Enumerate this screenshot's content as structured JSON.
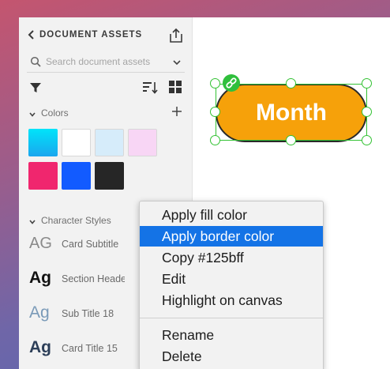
{
  "panel": {
    "header_title": "DOCUMENT ASSETS",
    "search_placeholder": "Search document assets",
    "colors_section": "Colors",
    "character_styles_section": "Character Styles",
    "colors": [
      {
        "name": "cyan",
        "value": "#12bff0"
      },
      {
        "name": "white",
        "value": "#ffffff"
      },
      {
        "name": "light-blue",
        "value": "#d6ecfa"
      },
      {
        "name": "light-pink",
        "value": "#f8d6f5"
      },
      {
        "name": "pink",
        "value": "#f0266e"
      },
      {
        "name": "blue",
        "value": "#125bff"
      },
      {
        "name": "dark",
        "value": "#262626"
      }
    ],
    "character_styles": [
      {
        "glyph": "AG",
        "name": "Card Subtitle"
      },
      {
        "glyph": "Ag",
        "name": "Section Header"
      },
      {
        "glyph": "Ag",
        "name": "Sub Title 18"
      },
      {
        "glyph": "Ag",
        "name": "Card Title 15"
      }
    ]
  },
  "canvas": {
    "shape_text": "Month",
    "shape_fill": "#f6a10a",
    "selection_color": "#33c233"
  },
  "context_menu": {
    "items": [
      "Apply fill color",
      "Apply border color",
      "Copy #125bff",
      "Edit",
      "Highlight on canvas",
      "Rename",
      "Delete"
    ],
    "active_item": "Apply border color",
    "highlight_color": "#1473e6"
  }
}
